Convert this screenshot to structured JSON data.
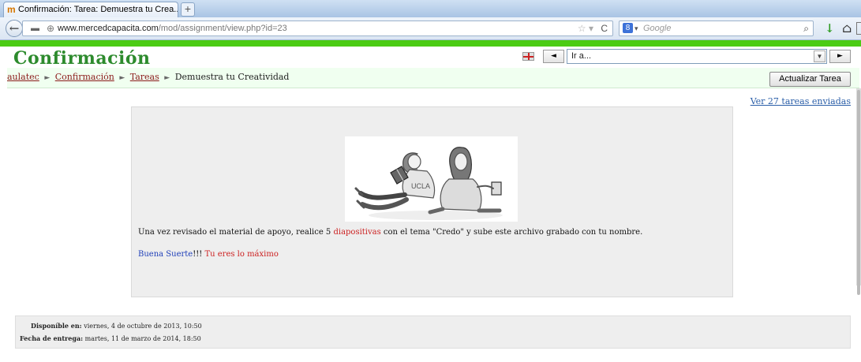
{
  "browser": {
    "tab_title": "Confirmación: Tarea: Demuestra tu Crea...",
    "new_tab": "+",
    "url_host": "www.mercedcapacita.com",
    "url_path": "/mod/assignment/view.php?id=23",
    "search_placeholder": "Google"
  },
  "header": {
    "site_title": "Confirmación",
    "jump_placeholder": "Ir a...",
    "prev_arrow": "◄",
    "next_arrow": "►",
    "dropdown_arrow": "▼"
  },
  "breadcrumb": {
    "items": [
      "aulatec",
      "Confirmación",
      "Tareas",
      "Demuestra tu Creatividad"
    ],
    "separator": "►"
  },
  "actions": {
    "update_button": "Actualizar Tarea",
    "submissions_link": "Ver 27 tareas enviadas"
  },
  "content": {
    "instr_pre": "Una vez revisado el material de apoyo, realice 5 ",
    "instr_highlight": "diapositivas",
    "instr_post": " con el tema \"Credo\" y sube este archivo grabado con tu nombre.",
    "luck_blue": "Buena Suerte",
    "luck_exclaim": "!!! ",
    "luck_red": "Tu eres lo máximo"
  },
  "dates": {
    "available_label": "Disponíble en:",
    "available_value": "viernes, 4 de octubre de 2013, 10:50",
    "due_label": "Fecha de entrega:",
    "due_value": "martes, 11 de marzo de 2014, 18:50"
  },
  "colors": {
    "title_green": "#2d8b2d",
    "accent_bar": "#4bcc14",
    "link_red": "#8b1a1a",
    "link_blue": "#2a5ea8",
    "highlight_red": "#cc2222",
    "highlight_blue": "#1f3fb8"
  }
}
